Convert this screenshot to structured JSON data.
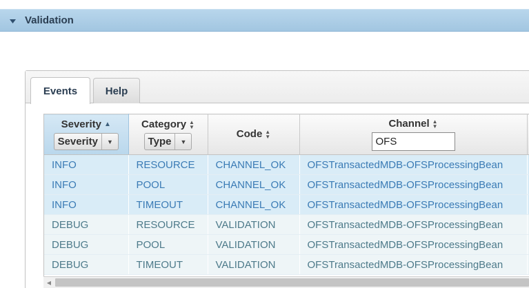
{
  "panel": {
    "title": "Validation",
    "toggle_icon": "triangle-down"
  },
  "tabs": [
    {
      "label": "Events",
      "active": true
    },
    {
      "label": "Help",
      "active": false
    }
  ],
  "grid": {
    "columns": {
      "severity": {
        "label": "Severity",
        "sort": "ascending",
        "filter_value": "Severity"
      },
      "category": {
        "label": "Category",
        "sort": "none",
        "filter_value": "Type"
      },
      "code": {
        "label": "Code",
        "sort": "none"
      },
      "channel": {
        "label": "Channel",
        "sort": "none",
        "filter_value": "OFS"
      }
    },
    "rows": [
      {
        "severity": "INFO",
        "category": "RESOURCE",
        "code": "CHANNEL_OK",
        "channel": "OFSTransactedMDB-OFSProcessingBean"
      },
      {
        "severity": "INFO",
        "category": "POOL",
        "code": "CHANNEL_OK",
        "channel": "OFSTransactedMDB-OFSProcessingBean"
      },
      {
        "severity": "INFO",
        "category": "TIMEOUT",
        "code": "CHANNEL_OK",
        "channel": "OFSTransactedMDB-OFSProcessingBean"
      },
      {
        "severity": "DEBUG",
        "category": "RESOURCE",
        "code": "VALIDATION",
        "channel": "OFSTransactedMDB-OFSProcessingBean"
      },
      {
        "severity": "DEBUG",
        "category": "POOL",
        "code": "VALIDATION",
        "channel": "OFSTransactedMDB-OFSProcessingBean"
      },
      {
        "severity": "DEBUG",
        "category": "TIMEOUT",
        "code": "VALIDATION",
        "channel": "OFSTransactedMDB-OFSProcessingBean"
      }
    ]
  },
  "colors": {
    "header_bg": "#a9cbe4",
    "info_row_bg": "#d9ecf7",
    "info_text": "#3a7bb5",
    "debug_row_bg": "#eef5f7",
    "debug_text": "#4d7a8a"
  }
}
